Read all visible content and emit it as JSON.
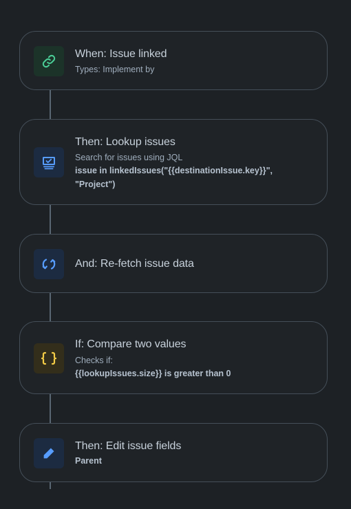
{
  "steps": [
    {
      "title": "When: Issue linked",
      "subtitle": "Types: Implement by",
      "icon": "link-icon",
      "icon_color": "#4bce97",
      "icon_bg": "#1c3329"
    },
    {
      "title": "Then: Lookup issues",
      "subtitle": "Search for issues using JQL",
      "detail": "issue in linkedIssues(\"{{destinationIssue.key}}\", \"Project\")",
      "icon": "lookup-monitor-icon",
      "icon_color": "#579dff",
      "icon_bg": "#1c2b41"
    },
    {
      "title": "And: Re-fetch issue data",
      "icon": "refresh-icon",
      "icon_color": "#579dff",
      "icon_bg": "#1c2b41"
    },
    {
      "title": "If: Compare two values",
      "subtitle": "Checks if:",
      "detail": "{{lookupIssues.size}} is greater than 0",
      "icon": "curly-braces-icon",
      "icon_color": "#f5cd47",
      "icon_bg": "#332e1b"
    },
    {
      "title": "Then: Edit issue fields",
      "detail": "Parent",
      "icon": "pencil-icon",
      "icon_color": "#579dff",
      "icon_bg": "#1c2b41"
    }
  ]
}
